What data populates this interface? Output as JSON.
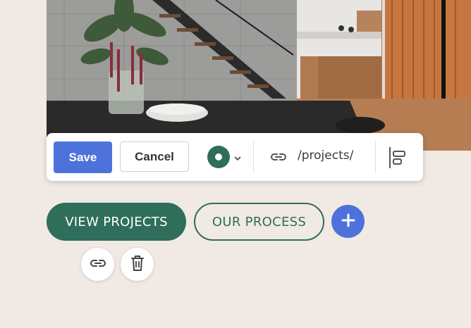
{
  "toolbar": {
    "save_label": "Save",
    "cancel_label": "Cancel",
    "link_url": "/projects/",
    "selected_color": "#2e6e5b"
  },
  "buttons": {
    "primary_label": "VIEW PROJECTS",
    "secondary_label": "OUR PROCESS"
  },
  "colors": {
    "accent": "#4e72dc",
    "brand_green": "#2e6e5b",
    "background": "#f1e9e4"
  },
  "icons": {
    "link": "link-icon",
    "align": "align-left-icon",
    "add": "plus-icon",
    "delete": "trash-icon",
    "chevron": "chevron-down-icon"
  }
}
